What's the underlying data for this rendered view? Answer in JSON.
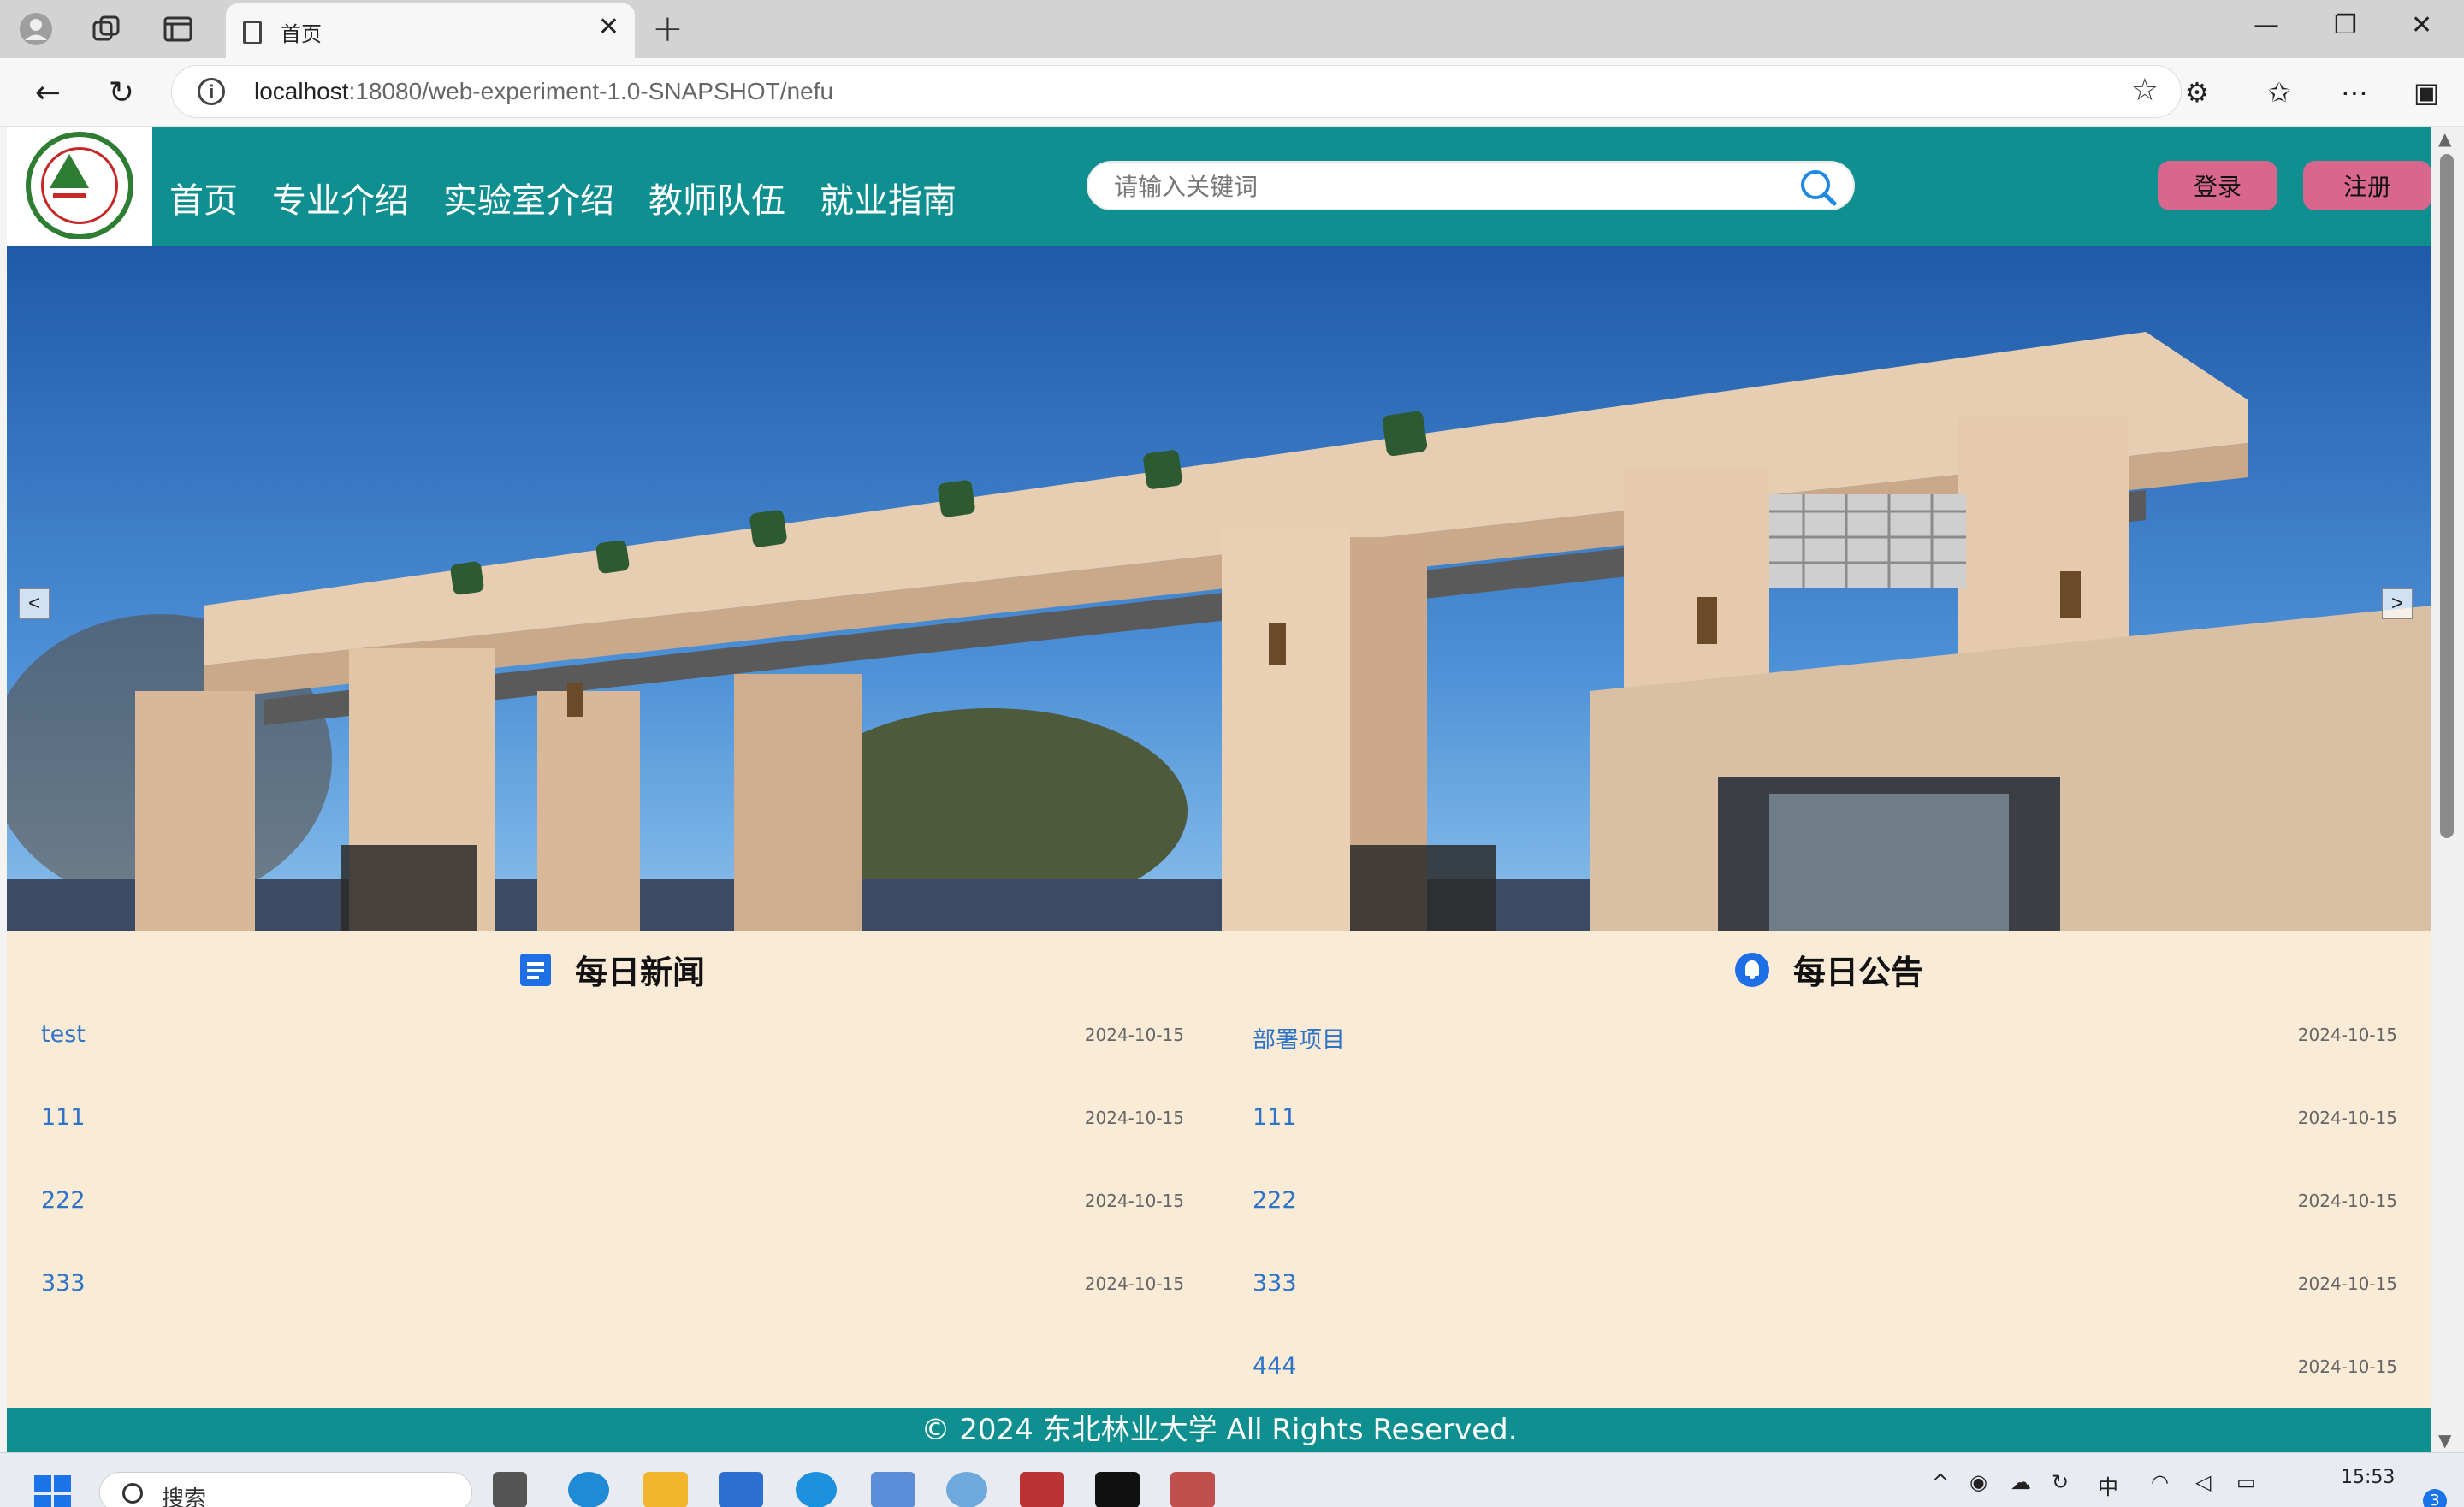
{
  "browser": {
    "tab_title": "首页",
    "url_host": "localhost",
    "url_rest": ":18080/web-experiment-1.0-SNAPSHOT/nefu"
  },
  "header": {
    "menu": [
      "首页",
      "专业介绍",
      "实验室介绍",
      "教师队伍",
      "就业指南"
    ],
    "search_placeholder": "请输入关键词",
    "login_label": "登录",
    "register_label": "注册"
  },
  "carousel": {
    "prev_label": "<",
    "next_label": ">"
  },
  "news": {
    "title": "每日新闻",
    "items": [
      {
        "text": "test",
        "date": "2024-10-15"
      },
      {
        "text": "111",
        "date": "2024-10-15"
      },
      {
        "text": "222",
        "date": "2024-10-15"
      },
      {
        "text": "333",
        "date": "2024-10-15"
      }
    ]
  },
  "notice": {
    "title": "每日公告",
    "items": [
      {
        "text": "部署项目",
        "date": "2024-10-15"
      },
      {
        "text": "111",
        "date": "2024-10-15"
      },
      {
        "text": "222",
        "date": "2024-10-15"
      },
      {
        "text": "333",
        "date": "2024-10-15"
      },
      {
        "text": "444",
        "date": "2024-10-15"
      }
    ]
  },
  "footer": {
    "text": "© 2024 东北林业大学 All Rights Reserved."
  },
  "taskbar": {
    "search_label": "搜索",
    "ime_label": "中",
    "time": "15:53",
    "notification_count": "3"
  },
  "colors": {
    "header_teal": "#0f8f8f",
    "page_bg": "#faebd7",
    "button_pink": "#d9668c",
    "link_blue": "#2d73c7"
  }
}
